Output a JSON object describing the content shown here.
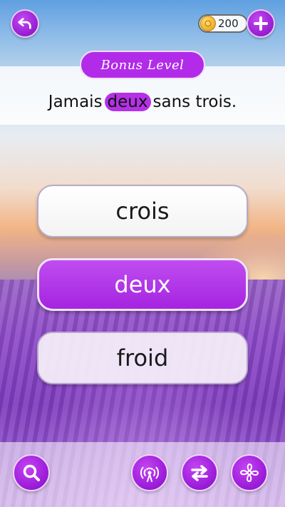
{
  "header": {
    "coins": "200"
  },
  "level": {
    "tag": "Bonus Level",
    "phrase_before": "Jamais",
    "phrase_highlight": "deux",
    "phrase_after": "sans trois."
  },
  "answers": [
    {
      "label": "crois",
      "state": "default"
    },
    {
      "label": "deux",
      "state": "selected"
    },
    {
      "label": "froid",
      "state": "default"
    }
  ],
  "colors": {
    "accent": "#b12be8",
    "highlight": "#b531e6"
  },
  "icons": {
    "back": "undo-arrow-icon",
    "add_coins": "plus-icon",
    "coin": "coin-icon",
    "hint": "magnifier-icon",
    "broadcast": "signal-icon",
    "swap": "shuffle-arrows-icon",
    "fan": "fan-icon"
  }
}
